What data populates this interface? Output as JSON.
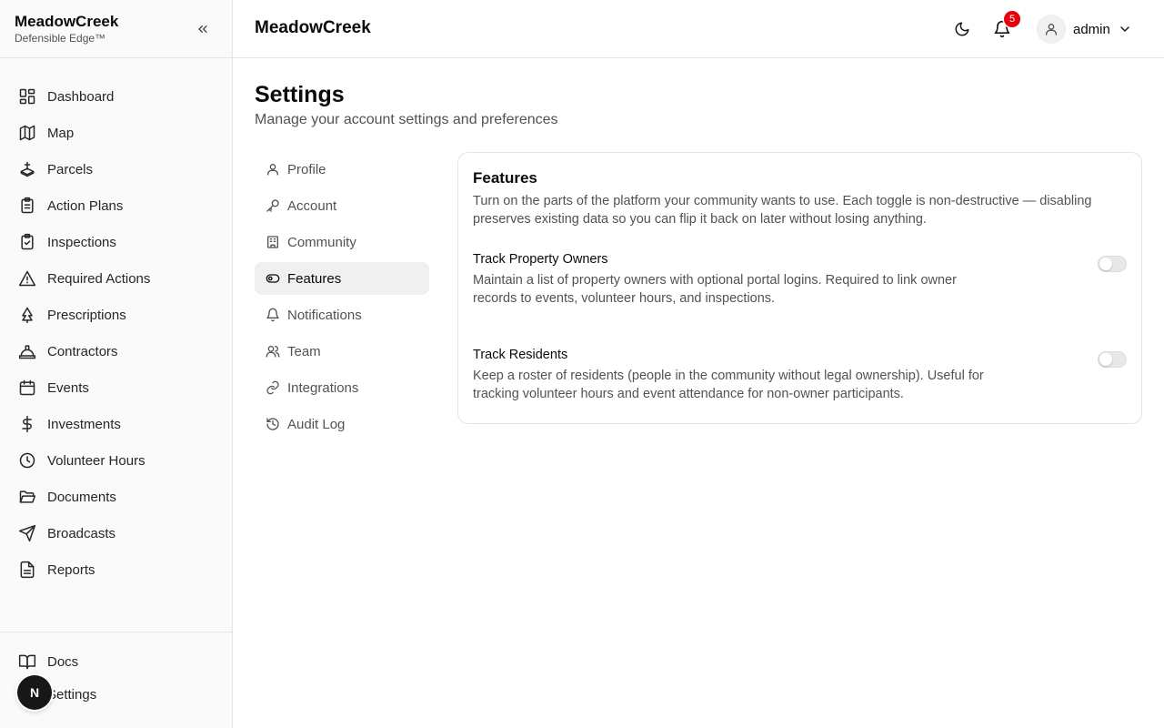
{
  "brand": {
    "name": "MeadowCreek",
    "tagline": "Defensible Edge™"
  },
  "sidebar": {
    "items": [
      {
        "label": "Dashboard",
        "icon": "layout-grid-icon"
      },
      {
        "label": "Map",
        "icon": "map-icon"
      },
      {
        "label": "Parcels",
        "icon": "parcels-icon"
      },
      {
        "label": "Action Plans",
        "icon": "clipboard-list-icon"
      },
      {
        "label": "Inspections",
        "icon": "clipboard-check-icon"
      },
      {
        "label": "Required Actions",
        "icon": "warning-triangle-icon"
      },
      {
        "label": "Prescriptions",
        "icon": "tree-icon"
      },
      {
        "label": "Contractors",
        "icon": "hard-hat-icon"
      },
      {
        "label": "Events",
        "icon": "calendar-icon"
      },
      {
        "label": "Investments",
        "icon": "dollar-icon"
      },
      {
        "label": "Volunteer Hours",
        "icon": "clock-icon"
      },
      {
        "label": "Documents",
        "icon": "folder-open-icon"
      },
      {
        "label": "Broadcasts",
        "icon": "send-icon"
      },
      {
        "label": "Reports",
        "icon": "file-text-icon"
      }
    ],
    "footer": [
      {
        "label": "Docs",
        "icon": "book-icon"
      },
      {
        "label": "Settings",
        "icon": "gear-icon"
      }
    ],
    "avatar_letter": "N"
  },
  "header": {
    "title": "MeadowCreek",
    "notification_count": "5",
    "user_name": "admin"
  },
  "page": {
    "title": "Settings",
    "subtitle": "Manage your account settings and preferences"
  },
  "settings_nav": [
    {
      "label": "Profile",
      "icon": "user-icon",
      "active": false
    },
    {
      "label": "Account",
      "icon": "key-icon",
      "active": false
    },
    {
      "label": "Community",
      "icon": "building-icon",
      "active": false
    },
    {
      "label": "Features",
      "icon": "toggle-icon",
      "active": true
    },
    {
      "label": "Notifications",
      "icon": "bell-icon",
      "active": false
    },
    {
      "label": "Team",
      "icon": "users-icon",
      "active": false
    },
    {
      "label": "Integrations",
      "icon": "link-icon",
      "active": false
    },
    {
      "label": "Audit Log",
      "icon": "history-icon",
      "active": false
    }
  ],
  "features_card": {
    "title": "Features",
    "description": "Turn on the parts of the platform your community wants to use. Each toggle is non-destructive — disabling preserves existing data so you can flip it back on later without losing anything.",
    "features": [
      {
        "title": "Track Property Owners",
        "description": "Maintain a list of property owners with optional portal logins. Required to link owner records to events, volunteer hours, and inspections.",
        "enabled": false
      },
      {
        "title": "Track Residents",
        "description": "Keep a roster of residents (people in the community without legal ownership). Useful for tracking volunteer hours and event attendance for non-owner participants.",
        "enabled": false
      }
    ]
  },
  "colors": {
    "badge": "#e7000b",
    "sidebar_bg": "#fafafa",
    "active_nav_bg": "#f0f0f0"
  }
}
